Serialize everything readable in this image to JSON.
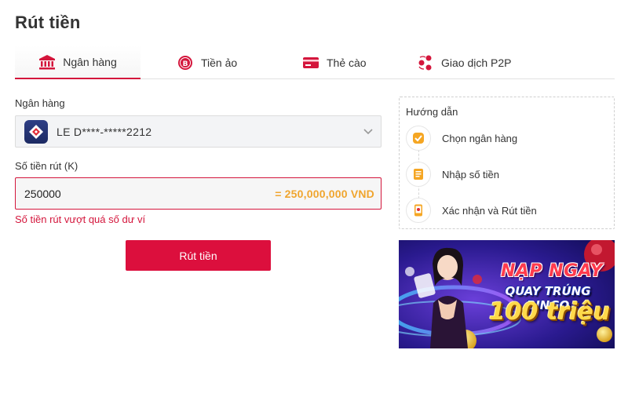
{
  "page": {
    "title": "Rút tiền"
  },
  "tabs": [
    {
      "label": "Ngân hàng",
      "icon": "bank-icon",
      "active": true
    },
    {
      "label": "Tiền ảo",
      "icon": "crypto-coin-icon",
      "active": false
    },
    {
      "label": "Thẻ cào",
      "icon": "scratch-card-icon",
      "active": false
    },
    {
      "label": "Giao dịch P2P",
      "icon": "p2p-transfer-icon",
      "active": false
    }
  ],
  "form": {
    "bank_label": "Ngân hàng",
    "bank_selected": "LE D****-*****2212",
    "bank_icon": "bank-logo-icon",
    "amount_label": "Số tiền rút (K)",
    "amount_value": "250000",
    "amount_converted": "= 250,000,000 VND",
    "error": "Số tiền rút vượt quá số dư ví",
    "submit_label": "Rút tiền"
  },
  "guide": {
    "title": "Hướng dẫn",
    "steps": [
      {
        "label": "Chọn ngân hàng",
        "icon": "check-badge-icon"
      },
      {
        "label": "Nhập số tiền",
        "icon": "note-icon"
      },
      {
        "label": "Xác nhận và Rút tiền",
        "icon": "phone-confirm-icon"
      }
    ]
  },
  "banner": {
    "line1": "NẠP NGAY",
    "line2": "QUAY TRÚNG BINGO",
    "line3": "100 triệu"
  },
  "colors": {
    "accent": "#dc0f3d",
    "error": "#d4163c",
    "converted": "#f0a52e"
  }
}
